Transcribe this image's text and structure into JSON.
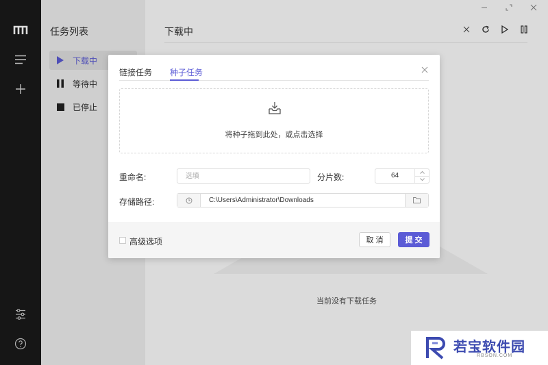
{
  "sidebar": {
    "icons": [
      "logo-icon",
      "menu-icon",
      "add-icon",
      "settings-sliders-icon",
      "help-icon"
    ]
  },
  "task_list": {
    "title": "任务列表",
    "items": [
      {
        "label": "下载中",
        "icon": "play-icon",
        "active": true
      },
      {
        "label": "等待中",
        "icon": "pause-icon",
        "active": false
      },
      {
        "label": "已停止",
        "icon": "stop-icon",
        "active": false
      }
    ]
  },
  "main": {
    "heading": "下载中",
    "empty_text": "当前没有下载任务"
  },
  "dialog": {
    "tabs": [
      {
        "label": "链接任务",
        "active": false
      },
      {
        "label": "种子任务",
        "active": true
      }
    ],
    "dropzone_text": "将种子拖到此处，或点击选择",
    "rename_label": "重命名:",
    "rename_placeholder": "选填",
    "shards_label": "分片数:",
    "shards_value": "64",
    "path_label": "存储路径:",
    "path_value": "C:\\Users\\Administrator\\Downloads",
    "advanced_label": "高级选项",
    "cancel_label": "取 消",
    "submit_label": "提 交"
  },
  "watermark": {
    "text": "若宝软件园",
    "sub": "RBSON.COM"
  },
  "colors": {
    "accent": "#5b5bd6",
    "rail": "#1a1a1a",
    "panel": "#f2f2f2"
  }
}
